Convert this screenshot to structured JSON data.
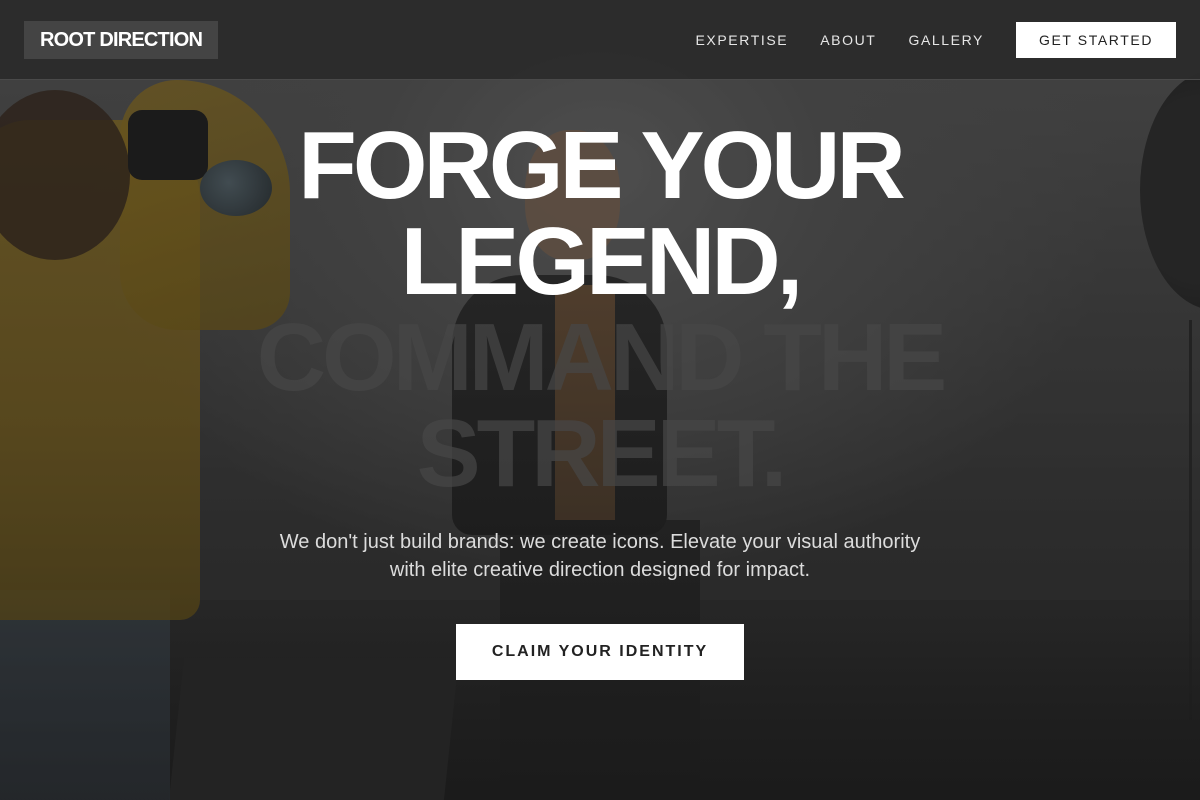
{
  "brand": {
    "logo_text": "ROOT DIRECTION"
  },
  "nav": {
    "links": [
      {
        "label": "EXPERTISE"
      },
      {
        "label": "ABOUT"
      },
      {
        "label": "GALLERY"
      }
    ],
    "cta_label": "GET STARTED"
  },
  "hero": {
    "headline_lines": [
      "FORGE YOUR",
      "LEGEND,",
      "COMMAND THE",
      "STREET."
    ],
    "subheadline": "We don't just build brands: we create icons. Elevate your visual authority with elite creative direction designed for impact.",
    "cta_label": "CLAIM YOUR IDENTITY"
  },
  "colors": {
    "nav_background": "#2c2c2c",
    "logo_background": "#444444",
    "button_background": "#ffffff",
    "button_text": "#222222",
    "headline_primary": "#ffffff",
    "headline_faded": "#464646",
    "photographer_jacket": "#9a7a23"
  }
}
